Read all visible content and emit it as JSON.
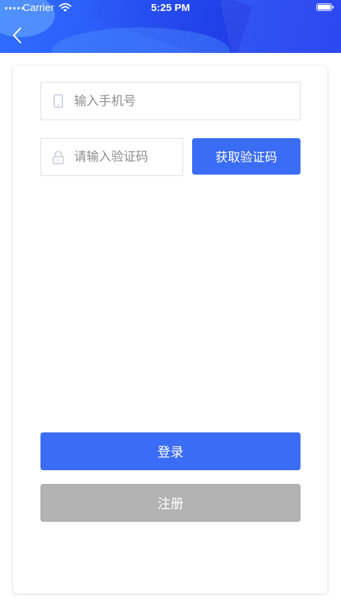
{
  "status_bar": {
    "carrier": "Carrier",
    "time": "5:25 PM",
    "wifi_icon": "wifi-icon",
    "battery_icon": "battery-full-icon"
  },
  "header": {
    "back_icon": "chevron-left-icon",
    "accent_start": "#2f6dff",
    "accent_end": "#1f3df0"
  },
  "form": {
    "phone": {
      "icon": "phone-icon",
      "placeholder": "输入手机号",
      "value": ""
    },
    "code": {
      "icon": "lock-icon",
      "placeholder": "请输入验证码",
      "value": ""
    },
    "get_code_label": "获取验证码",
    "login_label": "登录",
    "register_label": "注册"
  },
  "colors": {
    "primary": "#3a6cf5",
    "disabled": "#b3b3b3",
    "field_border": "#dedede"
  }
}
